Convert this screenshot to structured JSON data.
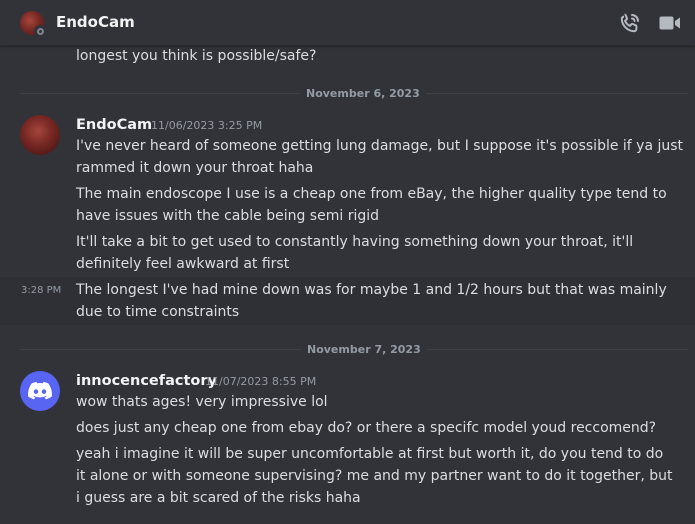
{
  "channel": {
    "name": "EndoCam"
  },
  "dividers": [
    {
      "label": "November 6, 2023"
    },
    {
      "label": "November 7, 2023"
    }
  ],
  "messages": {
    "prev_line": "longest you think is possible/safe?",
    "group1": {
      "author": "EndoCam",
      "timestamp": "11/06/2023 3:25 PM",
      "lines": [
        "I've never heard of someone getting lung damage, but I suppose it's possible if ya just",
        "rammed it down your throat haha",
        "The main endoscope I use is a cheap one from eBay, the higher quality type tend to",
        "have issues with the cable being semi rigid",
        "It'll take a bit to get used to constantly having something down your throat, it'll",
        "definitely feel awkward at first"
      ],
      "followup_time": "3:28 PM",
      "followup_lines": [
        "The longest I've had mine down was for maybe 1 and 1/2 hours but that was mainly",
        "due to time constraints"
      ]
    },
    "group2": {
      "author": "innocencefactory",
      "timestamp": "11/07/2023 8:55 PM",
      "lines": [
        "wow thats ages! very impressive lol",
        "does just any cheap one from ebay do? or there a specifc model youd reccomend?",
        "yeah i imagine it will be super uncomfortable at first but worth it, do you tend to do",
        "it alone or with someone supervising? me and my partner want to do it together, but",
        "i guess are a bit scared of the risks haha"
      ]
    }
  },
  "colors": {
    "background": "#313338",
    "accent": "#5865f2",
    "icon": "#b5bac1"
  },
  "icons": {
    "call": "phone-call-icon",
    "video": "video-camera-icon",
    "app": "discord-logo-icon"
  }
}
